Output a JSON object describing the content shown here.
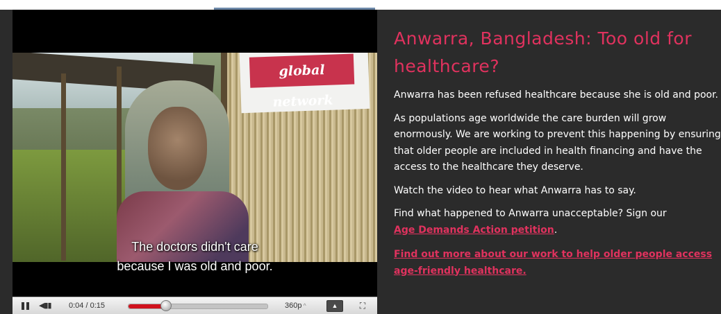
{
  "video": {
    "subtitle_line1": "The doctors didn't care",
    "subtitle_line2": "because I was old and poor.",
    "banner_text": "global network",
    "time_display": "0:04 / 0:15",
    "progress": 0.27,
    "quality": "360p",
    "caret": "^"
  },
  "article": {
    "title": "Anwarra, Bangladesh: Too old for healthcare?",
    "paragraph1": "Anwarra has been refused healthcare because she is old and poor.",
    "paragraph2": "As populations age worldwide the care burden will grow enormously. We are working to prevent this happening by ensuring that older people are included in health financing and have the access to the healthcare they deserve.",
    "paragraph3": "Watch the video to hear what Anwarra has to say.",
    "paragraph4_text": "Find what happened to Anwarra unacceptable? Sign our",
    "petition_link": "Age Demands Action petition",
    "paragraph4_end": ".",
    "more_link": "Find out more about our work to help older people access age-friendly healthcare."
  },
  "colors": {
    "background": "#2b2b2b",
    "accent": "#e0325e",
    "progress_fill": "#d0121d"
  }
}
